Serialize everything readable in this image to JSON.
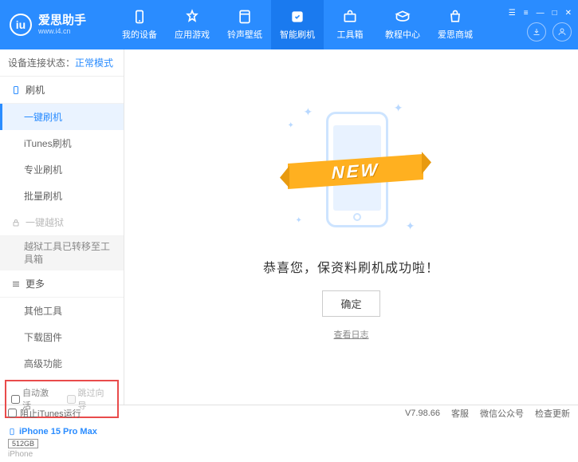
{
  "header": {
    "logo_title": "爱思助手",
    "logo_url": "www.i4.cn",
    "nav": [
      {
        "label": "我的设备"
      },
      {
        "label": "应用游戏"
      },
      {
        "label": "铃声壁纸"
      },
      {
        "label": "智能刷机"
      },
      {
        "label": "工具箱"
      },
      {
        "label": "教程中心"
      },
      {
        "label": "爱思商城"
      }
    ]
  },
  "sidebar": {
    "status_label": "设备连接状态：",
    "status_value": "正常模式",
    "section_flash": "刷机",
    "items_flash": [
      "一键刷机",
      "iTunes刷机",
      "专业刷机",
      "批量刷机"
    ],
    "section_jailbreak": "一键越狱",
    "jailbreak_note": "越狱工具已转移至工具箱",
    "section_more": "更多",
    "items_more": [
      "其他工具",
      "下载固件",
      "高级功能"
    ],
    "check_auto_activate": "自动激活",
    "check_skip_guide": "跳过向导",
    "device": {
      "name": "iPhone 15 Pro Max",
      "storage": "512GB",
      "type": "iPhone"
    }
  },
  "main": {
    "ribbon": "NEW",
    "success": "恭喜您，保资料刷机成功啦！",
    "ok": "确定",
    "view_log": "查看日志"
  },
  "footer": {
    "block_itunes": "阻止iTunes运行",
    "version": "V7.98.66",
    "links": [
      "客服",
      "微信公众号",
      "检查更新"
    ]
  }
}
